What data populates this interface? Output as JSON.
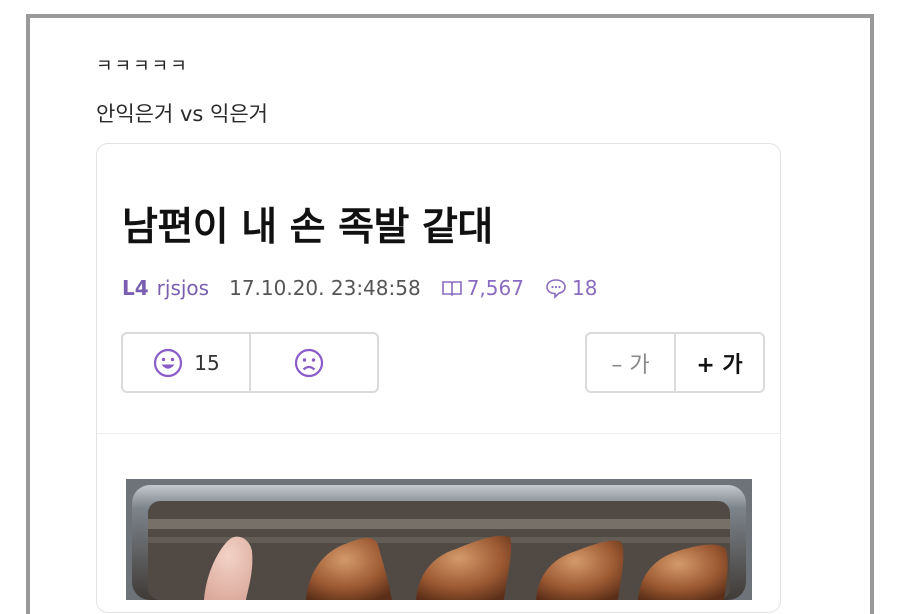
{
  "caption": {
    "line1": "ㅋㅋㅋㅋㅋ",
    "line2": "안익은거 vs 익은거"
  },
  "post": {
    "title": "남편이 내 손 족발 같대",
    "level": "L4",
    "username": "rjsjos",
    "datetime": "17.10.20. 23:48:58",
    "views": "7,567",
    "comments": "18",
    "views_icon": "book-icon",
    "comments_icon": "speech-bubble-icon"
  },
  "votes": {
    "like_count": "15",
    "like_icon": "happy-face-icon",
    "dislike_icon": "sad-face-icon"
  },
  "font_controls": {
    "smaller_label": "– 가",
    "larger_label": "+ 가"
  },
  "image": {
    "icon": "photo-icon"
  },
  "colors": {
    "accent": "#7a5fb0",
    "border": "#dadada",
    "frame": "#9a9a9a"
  }
}
